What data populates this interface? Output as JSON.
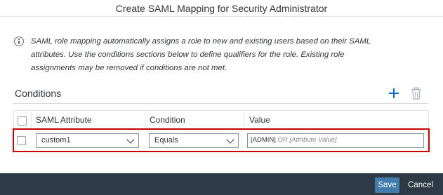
{
  "dialog": {
    "title": "Create SAML Mapping for Security Administrator"
  },
  "info": {
    "icon": "info-icon",
    "text": "SAML role mapping automatically assigns a role to new and existing users based on their SAML attributes. Use the conditions sections below to define qualifiers for the role. Existing role assignments may be removed if conditions are not met."
  },
  "conditions": {
    "title": "Conditions",
    "add_icon": "plus-icon",
    "delete_icon": "trash-icon",
    "columns": [
      "SAML Attribute",
      "Condition",
      "Value"
    ],
    "rows": [
      {
        "selected": false,
        "saml_attribute": "custom1",
        "condition": "Equals",
        "value_token": "[ADMIN]",
        "value_placeholder": "OR [Attribute Value]"
      }
    ]
  },
  "footer": {
    "save_label": "Save",
    "cancel_label": "Cancel"
  },
  "colors": {
    "accent": "#0a6ed1",
    "save_bg": "#427cac",
    "footer_bg": "#2d3943",
    "highlight": "#cc0000"
  }
}
